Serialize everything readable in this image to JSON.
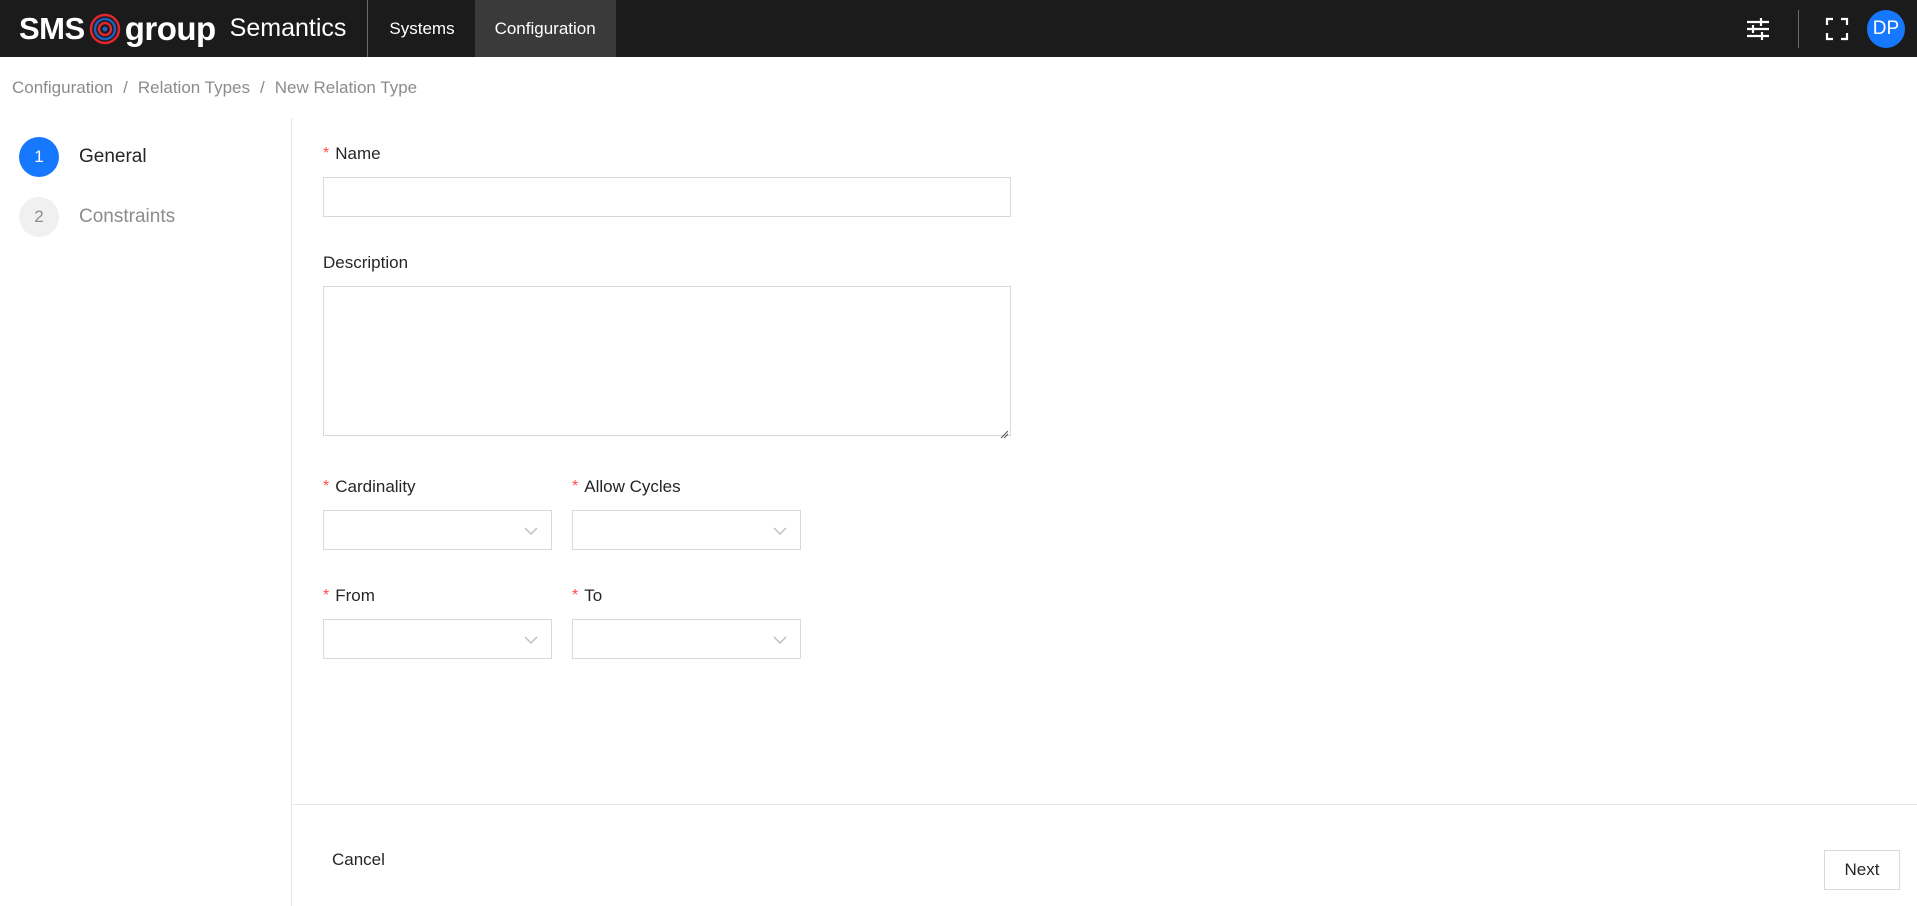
{
  "header": {
    "logo_left": "SMS",
    "logo_right": "group",
    "product": "Semantics",
    "nav": [
      {
        "label": "Systems",
        "active": false
      },
      {
        "label": "Configuration",
        "active": true
      }
    ],
    "icons": [
      "sliders-icon",
      "fullscreen-icon"
    ],
    "avatar_initials": "DP",
    "accent_color": "#1677ff"
  },
  "breadcrumb": {
    "items": [
      "Configuration",
      "Relation Types",
      "New Relation Type"
    ],
    "separator": "/"
  },
  "steps": [
    {
      "number": "1",
      "label": "General",
      "active": true
    },
    {
      "number": "2",
      "label": "Constraints",
      "active": false
    }
  ],
  "form": {
    "name": {
      "label": "Name",
      "required": true,
      "value": ""
    },
    "description": {
      "label": "Description",
      "required": false,
      "value": ""
    },
    "cardinality": {
      "label": "Cardinality",
      "required": true,
      "value": ""
    },
    "allow_cycles": {
      "label": "Allow Cycles",
      "required": true,
      "value": ""
    },
    "from": {
      "label": "From",
      "required": true,
      "value": ""
    },
    "to": {
      "label": "To",
      "required": true,
      "value": ""
    },
    "required_marker": "*"
  },
  "footer": {
    "cancel_label": "Cancel",
    "next_label": "Next"
  }
}
